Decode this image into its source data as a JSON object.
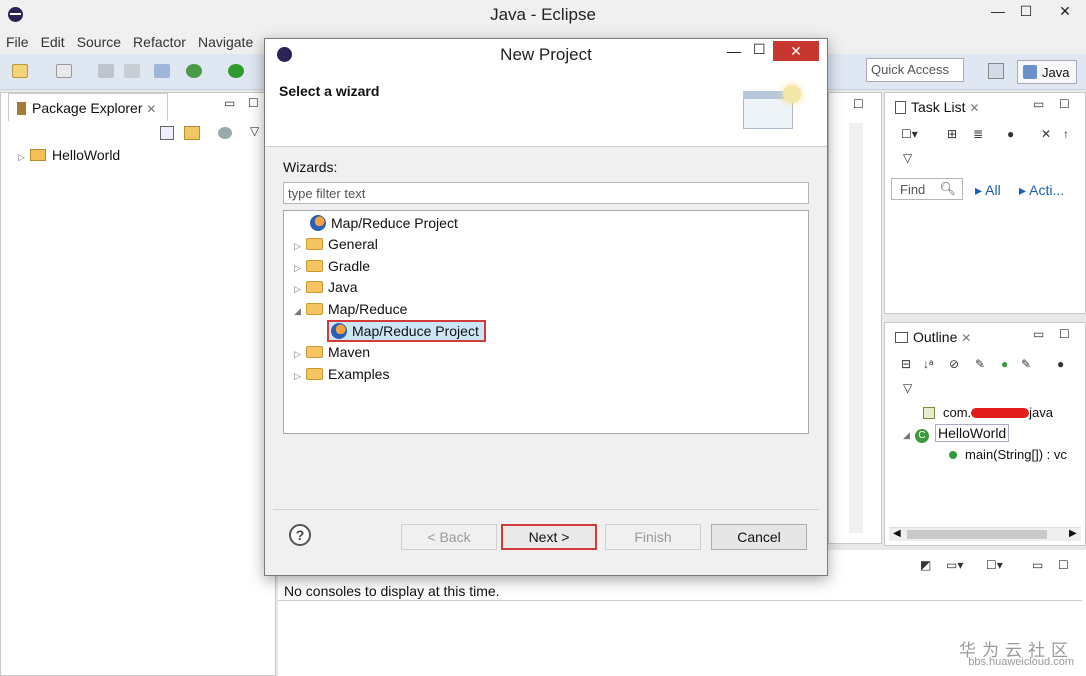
{
  "window": {
    "title": "Java - Eclipse",
    "controls": {
      "minimize": "—",
      "maximize": "☐",
      "close": "✕"
    }
  },
  "menu": [
    "File",
    "Edit",
    "Source",
    "Refactor",
    "Navigate"
  ],
  "toolbar": {
    "quick_access": "Quick Access",
    "perspective": "Java"
  },
  "package_explorer": {
    "title": "Package Explorer",
    "items": [
      {
        "label": "HelloWorld"
      }
    ]
  },
  "task_list": {
    "title": "Task List",
    "find_placeholder": "Find",
    "all": "All",
    "activate": "Acti..."
  },
  "outline": {
    "title": "Outline",
    "items": [
      "com.",
      "java",
      "HelloWorld",
      "main(String[]) : vc"
    ]
  },
  "console": {
    "message": "No consoles to display at this time."
  },
  "dialog": {
    "title": "New Project",
    "heading": "Select a wizard",
    "wizards_label": "Wizards:",
    "filter_placeholder": "type filter text",
    "tree": [
      {
        "label": "Map/Reduce Project",
        "type": "project",
        "level": 0
      },
      {
        "label": "General",
        "type": "folder",
        "level": 0,
        "expanded": false
      },
      {
        "label": "Gradle",
        "type": "folder",
        "level": 0,
        "expanded": false
      },
      {
        "label": "Java",
        "type": "folder",
        "level": 0,
        "expanded": false
      },
      {
        "label": "Map/Reduce",
        "type": "folder",
        "level": 0,
        "expanded": true
      },
      {
        "label": "Map/Reduce Project",
        "type": "project",
        "level": 1,
        "selected": true
      },
      {
        "label": "Maven",
        "type": "folder",
        "level": 0,
        "expanded": false
      },
      {
        "label": "Examples",
        "type": "folder",
        "level": 0,
        "expanded": false
      }
    ],
    "buttons": {
      "help": "?",
      "back": "< Back",
      "next": "Next >",
      "finish": "Finish",
      "cancel": "Cancel"
    }
  },
  "watermark": {
    "brand": "华为云社区",
    "url": "bbs.huaweicloud.com"
  }
}
